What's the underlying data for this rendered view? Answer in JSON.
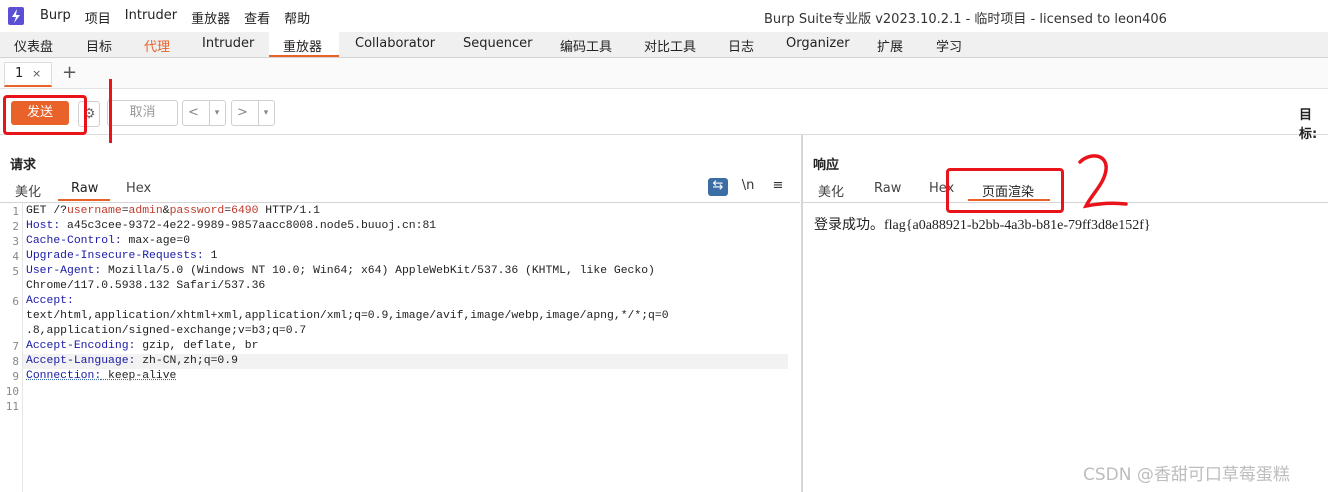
{
  "app": {
    "menu": [
      "Burp",
      "项目",
      "Intruder",
      "重放器",
      "查看",
      "帮助"
    ],
    "window_title": "Burp Suite专业版  v2023.10.2.1 - 临时项目 - licensed to leon406"
  },
  "tabs": [
    "仪表盘",
    "目标",
    "代理",
    "Intruder",
    "重放器",
    "Collaborator",
    "Sequencer",
    "编码工具",
    "对比工具",
    "日志",
    "Organizer",
    "扩展",
    "学习"
  ],
  "repeater_tab": {
    "label": "1",
    "close": "×",
    "add": "+"
  },
  "toolbar": {
    "send_label": "发送",
    "cancel_label": "取消",
    "back": "<",
    "forward": ">",
    "dropdown": "▾",
    "target_label": "目标:"
  },
  "request": {
    "title": "请求",
    "tabs": [
      "美化",
      "Raw",
      "Hex"
    ],
    "icons": {
      "newline": "\\n",
      "menu": "≡"
    },
    "line_numbers": [
      "1",
      "2",
      "3",
      "4",
      "5",
      "",
      "6",
      "",
      "",
      "7",
      "8",
      "9",
      "10",
      "11"
    ]
  },
  "request_lines": {
    "l1_a": "GET /?",
    "l1_p1": "username",
    "l1_e1": "=",
    "l1_v1": "admin",
    "l1_amp": "&",
    "l1_p2": "password",
    "l1_e2": "=",
    "l1_v2": "6490",
    "l1_b": " HTTP/1.1",
    "l2_k": "Host:",
    "l2_v": " a45c3cee-9372-4e22-9989-9857aacc8008.node5.buuoj.cn:81",
    "l3_k": "Cache-Control:",
    "l3_v": " max-age=0",
    "l4_k": "Upgrade-Insecure-Requests:",
    "l4_v": " 1",
    "l5_k": "User-Agent:",
    "l5_v": " Mozilla/5.0 (Windows NT 10.0; Win64; x64) AppleWebKit/537.36 (KHTML, like Gecko)",
    "l5_v2": "Chrome/117.0.5938.132 Safari/537.36",
    "l6_k": "Accept:",
    "l6_v": "text/html,application/xhtml+xml,application/xml;q=0.9,image/avif,image/webp,image/apng,*/*;q=0",
    "l6_v2": ".8,application/signed-exchange;v=b3;q=0.7",
    "l7_k": "Accept-Encoding:",
    "l7_v": " gzip, deflate, br",
    "l8_k": "Accept-Language:",
    "l8_v": " zh-CN,zh;q=0.9",
    "l9_k": "Connection:",
    "l9_v": " keep-alive"
  },
  "response": {
    "title": "响应",
    "tabs": [
      "美化",
      "Raw",
      "Hex",
      "页面渲染"
    ],
    "rendered_text": "登录成功。flag{a0a88921-b2bb-4a3b-b81e-79ff3d8e152f}"
  },
  "watermark": "CSDN @香甜可口草莓蛋糕",
  "colors": {
    "accent": "#e8622a",
    "annotation": "#e8141a",
    "header_key": "#1a1aa6"
  }
}
